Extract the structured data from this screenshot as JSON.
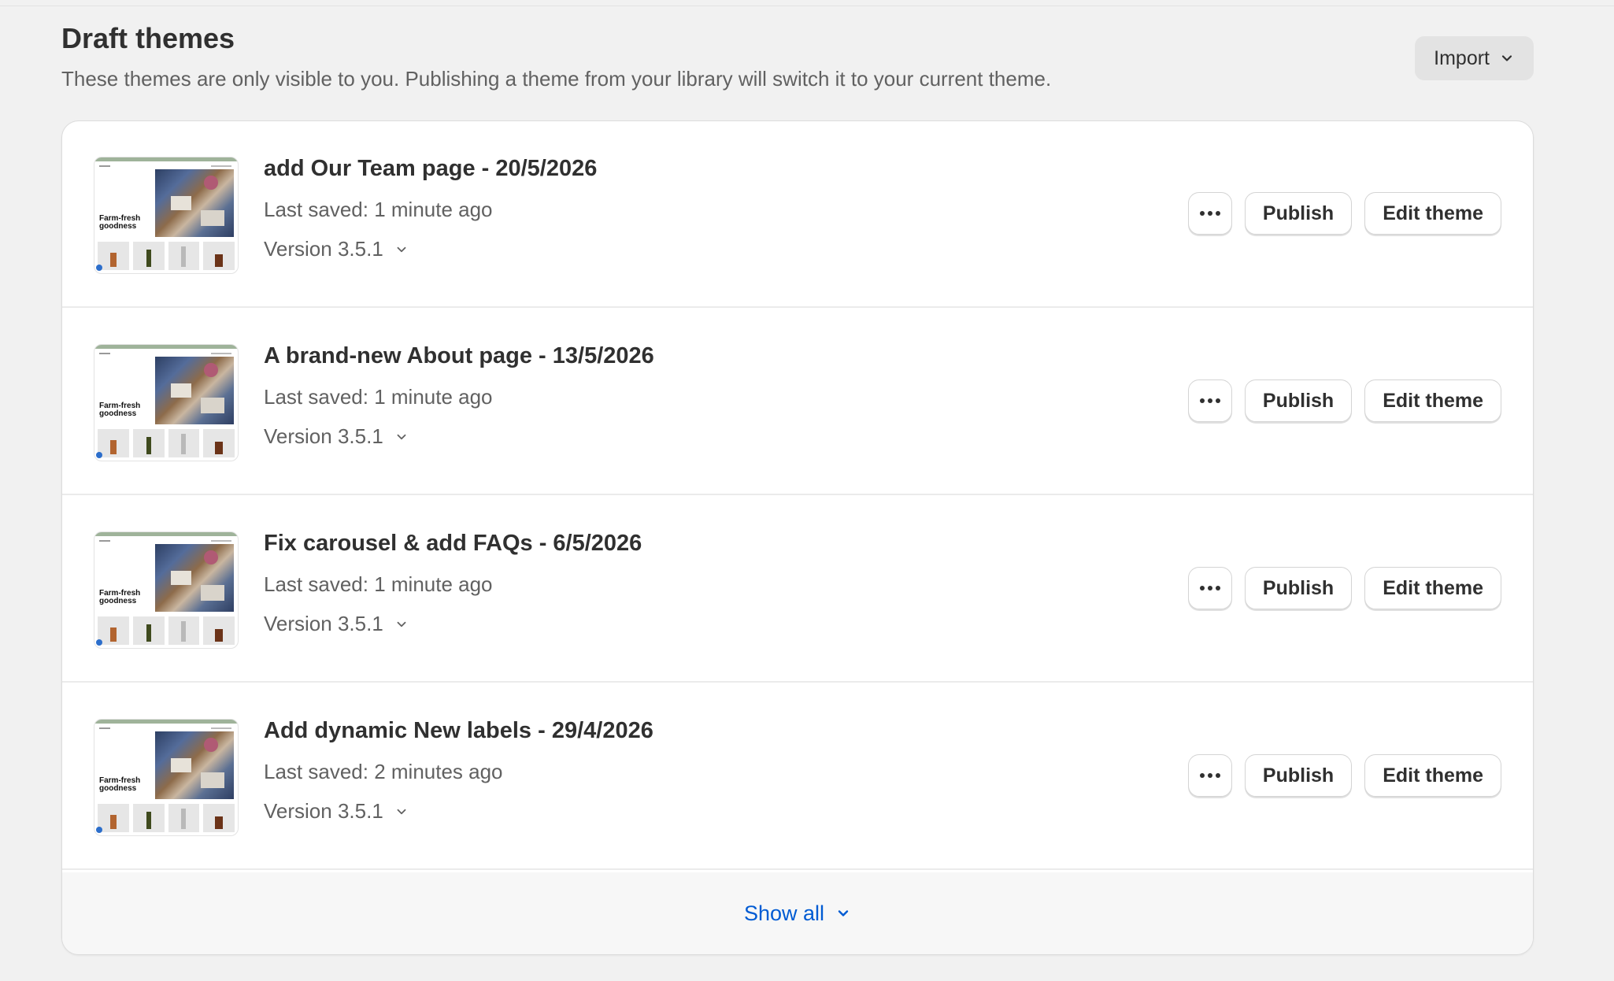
{
  "section": {
    "title": "Draft themes",
    "description": "These themes are only visible to you. Publishing a theme from your library will switch it to your current theme.",
    "import_label": "Import",
    "import_icon": "chevron-down-icon"
  },
  "thumbnail": {
    "hero_text": "Farm-fresh goodness"
  },
  "themes": [
    {
      "title": "add Our Team page - 20/5/2026",
      "saved": "Last saved: 1 minute ago",
      "version": "Version 3.5.1",
      "publish_label": "Publish",
      "edit_label": "Edit theme"
    },
    {
      "title": "A brand-new About page - 13/5/2026",
      "saved": "Last saved: 1 minute ago",
      "version": "Version 3.5.1",
      "publish_label": "Publish",
      "edit_label": "Edit theme"
    },
    {
      "title": "Fix carousel & add FAQs - 6/5/2026",
      "saved": "Last saved: 1 minute ago",
      "version": "Version 3.5.1",
      "publish_label": "Publish",
      "edit_label": "Edit theme"
    },
    {
      "title": "Add dynamic New labels - 29/4/2026",
      "saved": "Last saved: 2 minutes ago",
      "version": "Version 3.5.1",
      "publish_label": "Publish",
      "edit_label": "Edit theme"
    }
  ],
  "footer": {
    "show_all_label": "Show all"
  },
  "colors": {
    "page_bg": "#f1f1f1",
    "card_bg": "#ffffff",
    "link": "#005bd3",
    "text_primary": "#303030",
    "text_secondary": "#616161"
  }
}
